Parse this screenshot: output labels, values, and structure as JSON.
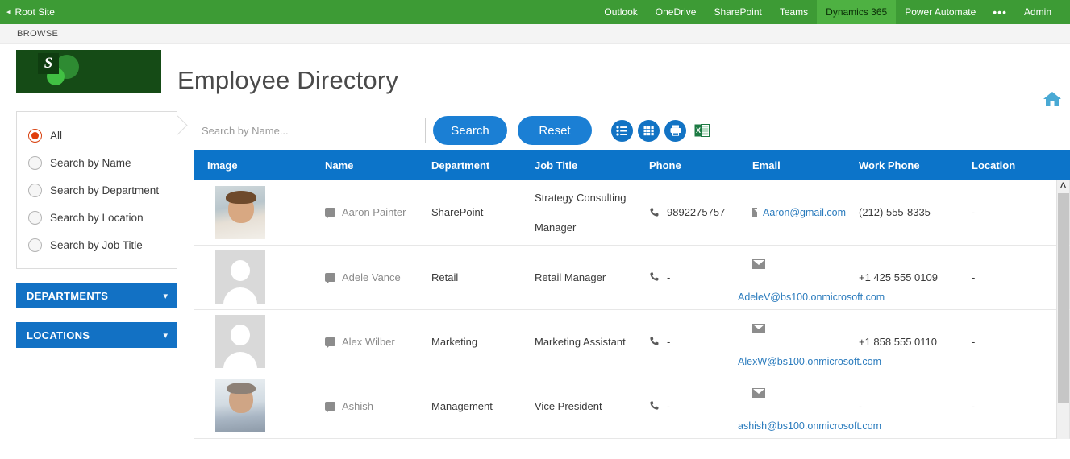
{
  "suitebar": {
    "back_icon": "back-arrow-icon",
    "root_site": "Root Site",
    "links": [
      {
        "label": "Outlook",
        "active": false
      },
      {
        "label": "OneDrive",
        "active": false
      },
      {
        "label": "SharePoint",
        "active": false
      },
      {
        "label": "Teams",
        "active": false
      },
      {
        "label": "Dynamics 365",
        "active": true
      },
      {
        "label": "Power Automate",
        "active": false
      }
    ],
    "ellipsis": "•••",
    "admin": "Admin",
    "bar_color": "#3d9b35",
    "active_color": "#4eb142"
  },
  "ribbon": {
    "browse_tab": "BROWSE"
  },
  "header": {
    "logo_letter": "S",
    "title": "Employee Directory",
    "home_icon": "home-icon",
    "home_color": "#49a9d4"
  },
  "sidebar": {
    "filters": [
      {
        "label": "All",
        "checked": true
      },
      {
        "label": "Search by Name",
        "checked": false
      },
      {
        "label": "Search by Department",
        "checked": false
      },
      {
        "label": "Search by Location",
        "checked": false
      },
      {
        "label": "Search by Job Title",
        "checked": false
      }
    ],
    "accordions": [
      {
        "label": "DEPARTMENTS",
        "chevron": "⌄"
      },
      {
        "label": "LOCATIONS",
        "chevron": "⌄"
      }
    ],
    "accent_color": "#1271c4",
    "radio_color": "#e03e0c"
  },
  "toolbar": {
    "search_placeholder": "Search by Name...",
    "search_value": "",
    "search_label": "Search",
    "reset_label": "Reset",
    "view_icons": [
      "list-view-icon",
      "grid-view-icon",
      "print-icon",
      "excel-export-icon"
    ],
    "button_color": "#1b7fd4"
  },
  "table": {
    "header_color": "#0c74c9",
    "columns": [
      "Image",
      "Name",
      "Department",
      "Job Title",
      "Phone",
      "Email",
      "Work Phone",
      "Location"
    ],
    "rows": [
      {
        "avatar": "photo-male-glasses",
        "name": "Aaron Painter",
        "department": "SharePoint",
        "job_title_line1": "Strategy Consulting",
        "job_title_line2": "Manager",
        "phone": "9892275757",
        "email": "Aaron@gmail.com",
        "email_layout": "inline",
        "work_phone": "(212) 555-8335",
        "location": "-"
      },
      {
        "avatar": "placeholder",
        "name": "Adele Vance",
        "department": "Retail",
        "job_title_line1": "Retail Manager",
        "job_title_line2": "",
        "phone": "-",
        "email": "AdeleV@bs100.onmicrosoft.com",
        "email_layout": "stacked",
        "work_phone": "+1 425 555 0109",
        "location": "-"
      },
      {
        "avatar": "placeholder",
        "name": "Alex Wilber",
        "department": "Marketing",
        "job_title_line1": "Marketing Assistant",
        "job_title_line2": "",
        "phone": "-",
        "email": "AlexW@bs100.onmicrosoft.com",
        "email_layout": "stacked",
        "work_phone": "+1 858 555 0110",
        "location": "-"
      },
      {
        "avatar": "photo-male-suit",
        "name": "Ashish",
        "department": "Management",
        "job_title_line1": "Vice President",
        "job_title_line2": "",
        "phone": "-",
        "email": "ashish@bs100.onmicrosoft.com",
        "email_layout": "stacked",
        "work_phone": "-",
        "location": "-"
      }
    ]
  },
  "scrollbar": {
    "up_arrow": "˄"
  }
}
